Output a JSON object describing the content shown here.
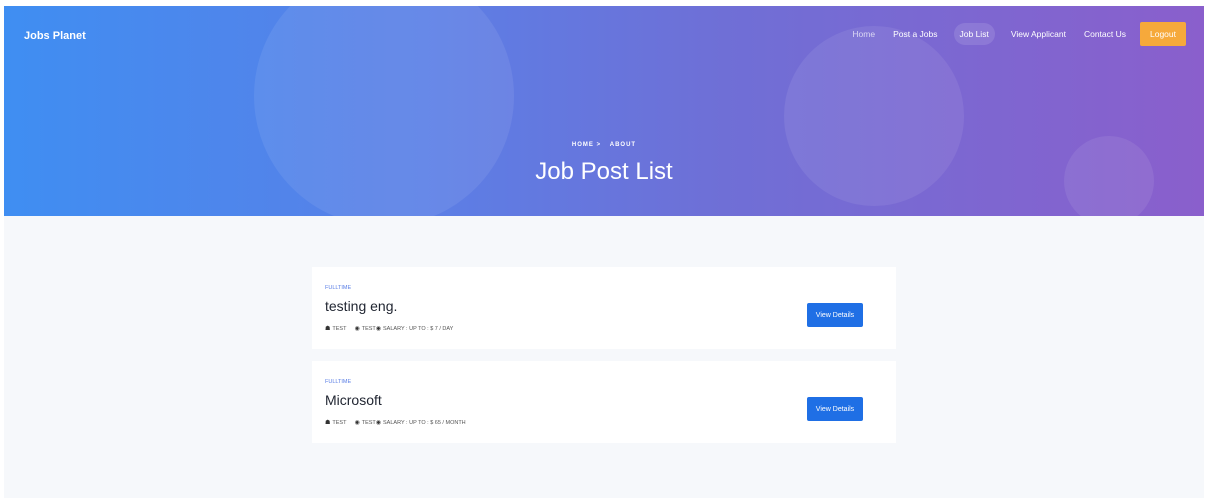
{
  "brand": "Jobs Planet",
  "nav": {
    "items": [
      {
        "label": "Home"
      },
      {
        "label": "Post a Jobs"
      },
      {
        "label": "Job List"
      },
      {
        "label": "View Applicant"
      },
      {
        "label": "Contact Us"
      }
    ],
    "logout_label": "Logout"
  },
  "hero": {
    "crumb_home": "HOME >",
    "crumb_about": "ABOUT",
    "title": "Job Post List"
  },
  "jobs": [
    {
      "type": "FULLTIME",
      "title": "testing eng.",
      "company": "TEST",
      "location": "TEST",
      "salary": "SALARY : UP TO : $ 7 / DAY",
      "button": "View Details"
    },
    {
      "type": "FULLTIME",
      "title": "Microsoft",
      "company": "TEST",
      "location": "TEST",
      "salary": "SALARY : UP TO : $ 65 / MONTH",
      "button": "View Details"
    }
  ],
  "colors": {
    "accent": "#1f6fe5",
    "logout": "#f6a93b"
  }
}
